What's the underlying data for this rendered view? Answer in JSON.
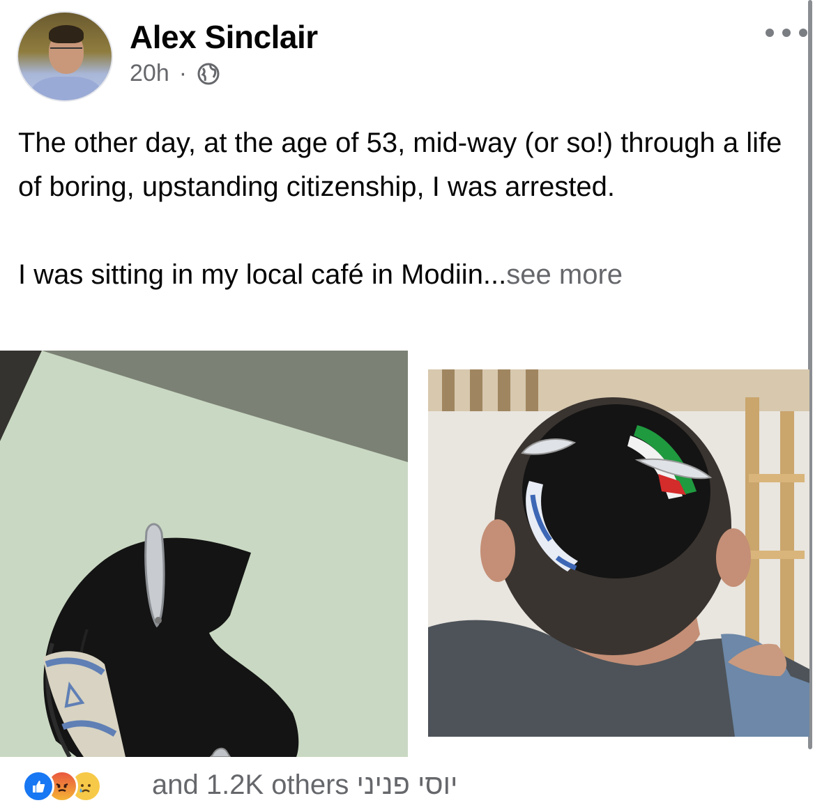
{
  "post": {
    "author": "Alex Sinclair",
    "time": "20h",
    "separator": "·",
    "privacy_icon": "globe-icon",
    "more_icon": "more-dots-icon",
    "text_line1": "The other day, at the age of 53, mid-way (or so!) through a life of boring, upstanding citizenship, I was arrested.",
    "text_line2": "I was sitting in my local café in Modiin...",
    "see_more": "see more"
  },
  "reactions": {
    "icons": [
      "like-icon",
      "angry-icon",
      "sad-icon"
    ],
    "summary": "and 1.2K others יוסי פניני",
    "colors": {
      "like": "#1877f2",
      "angry": "#e9573f",
      "sad": "#f7c948"
    }
  }
}
